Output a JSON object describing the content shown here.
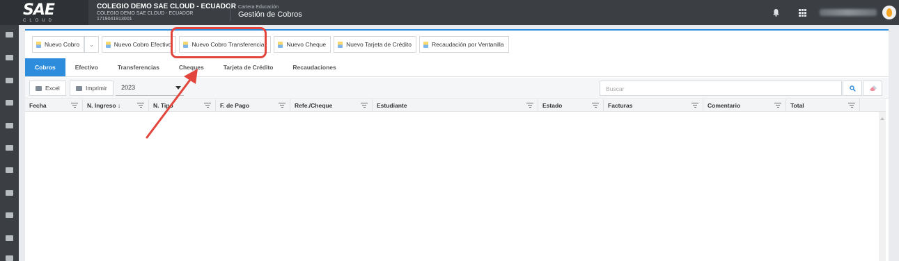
{
  "header": {
    "logo_text": "SAE",
    "logo_sub": "CLOUD",
    "school_name": "COLEGIO DEMO SAE CLOUD - ECUADOR",
    "school_sub": "COLEGIO DEMO SAE CLOUD - ECUADOR",
    "school_id": "1719041913001",
    "module_category": "Cartera Educación",
    "module_title": "Gestión de Cobros"
  },
  "actions": {
    "nuevo_cobro": "Nuevo Cobro",
    "nuevo_cobro_efectivo": "Nuevo Cobro Efectivo",
    "nuevo_cobro_transferencia": "Nuevo Cobro Transferencia",
    "nuevo_cheque": "Nuevo Cheque",
    "nuevo_tarjeta": "Nuevo Tarjeta de Crédito",
    "recaudacion_ventanilla": "Recaudación por Ventanilla"
  },
  "tabs": [
    "Cobros",
    "Efectivo",
    "Transferencias",
    "Cheques",
    "Tarjeta de Crédito",
    "Recaudaciones"
  ],
  "toolbar": {
    "excel": "Excel",
    "imprimir": "Imprimir",
    "year": "2023",
    "search_placeholder": "Buscar"
  },
  "table": {
    "columns": [
      "Fecha",
      "N. Ingreso ↓",
      "N. Tipo",
      "F. de Pago",
      "Refe./Cheque",
      "Estudiante",
      "Estado",
      "Facturas",
      "Comentario",
      "Total"
    ]
  },
  "colors": {
    "accent": "#2d8cdc",
    "annotation": "#e2453c",
    "topbar": "#3b3f44"
  }
}
